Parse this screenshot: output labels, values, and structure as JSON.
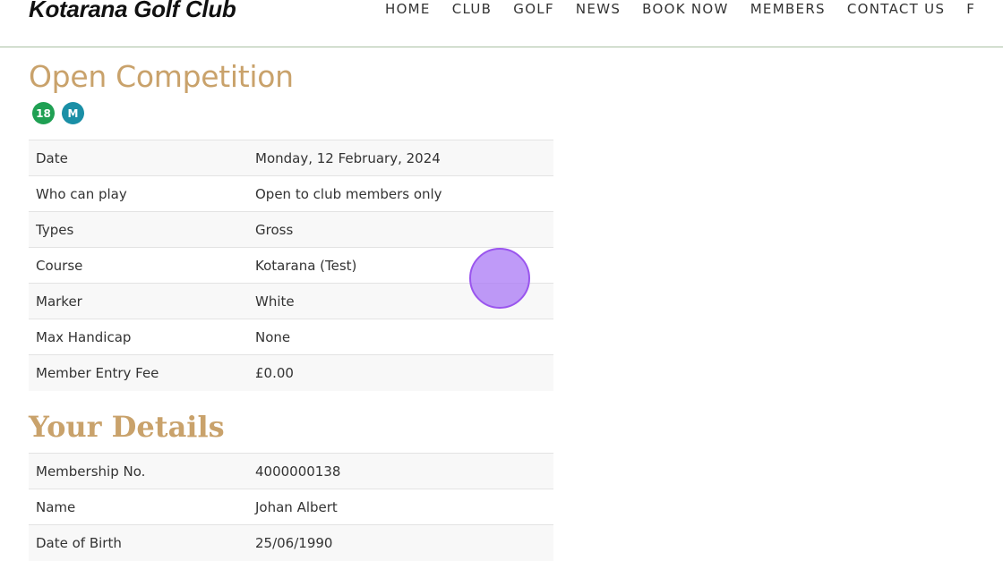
{
  "header": {
    "logo": "Kotarana Golf Club",
    "nav": [
      {
        "label": "HOME"
      },
      {
        "label": "CLUB"
      },
      {
        "label": "GOLF"
      },
      {
        "label": "NEWS"
      },
      {
        "label": "BOOK NOW"
      },
      {
        "label": "MEMBERS"
      },
      {
        "label": "CONTACT US"
      },
      {
        "label": "F"
      }
    ]
  },
  "competition": {
    "title": "Open Competition",
    "badges": {
      "holes": "18",
      "members": "M"
    },
    "rows": [
      {
        "label": "Date",
        "value": "Monday, 12 February, 2024"
      },
      {
        "label": "Who can play",
        "value": "Open to club members only"
      },
      {
        "label": "Types",
        "value": "Gross"
      },
      {
        "label": "Course",
        "value": "Kotarana (Test)"
      },
      {
        "label": "Marker",
        "value": "White"
      },
      {
        "label": "Max Handicap",
        "value": "None"
      },
      {
        "label": "Member Entry Fee",
        "value": "£0.00"
      }
    ]
  },
  "details": {
    "title": "Your Details",
    "rows": [
      {
        "label": "Membership No.",
        "value": "4000000138"
      },
      {
        "label": "Name",
        "value": "Johan Albert"
      },
      {
        "label": "Date of Birth",
        "value": "25/06/1990"
      }
    ]
  },
  "colors": {
    "accent_gold": "#c9a26b",
    "badge_green": "#1fa053",
    "badge_teal": "#1a8fa6",
    "click_indicator": "#9a55ee"
  }
}
